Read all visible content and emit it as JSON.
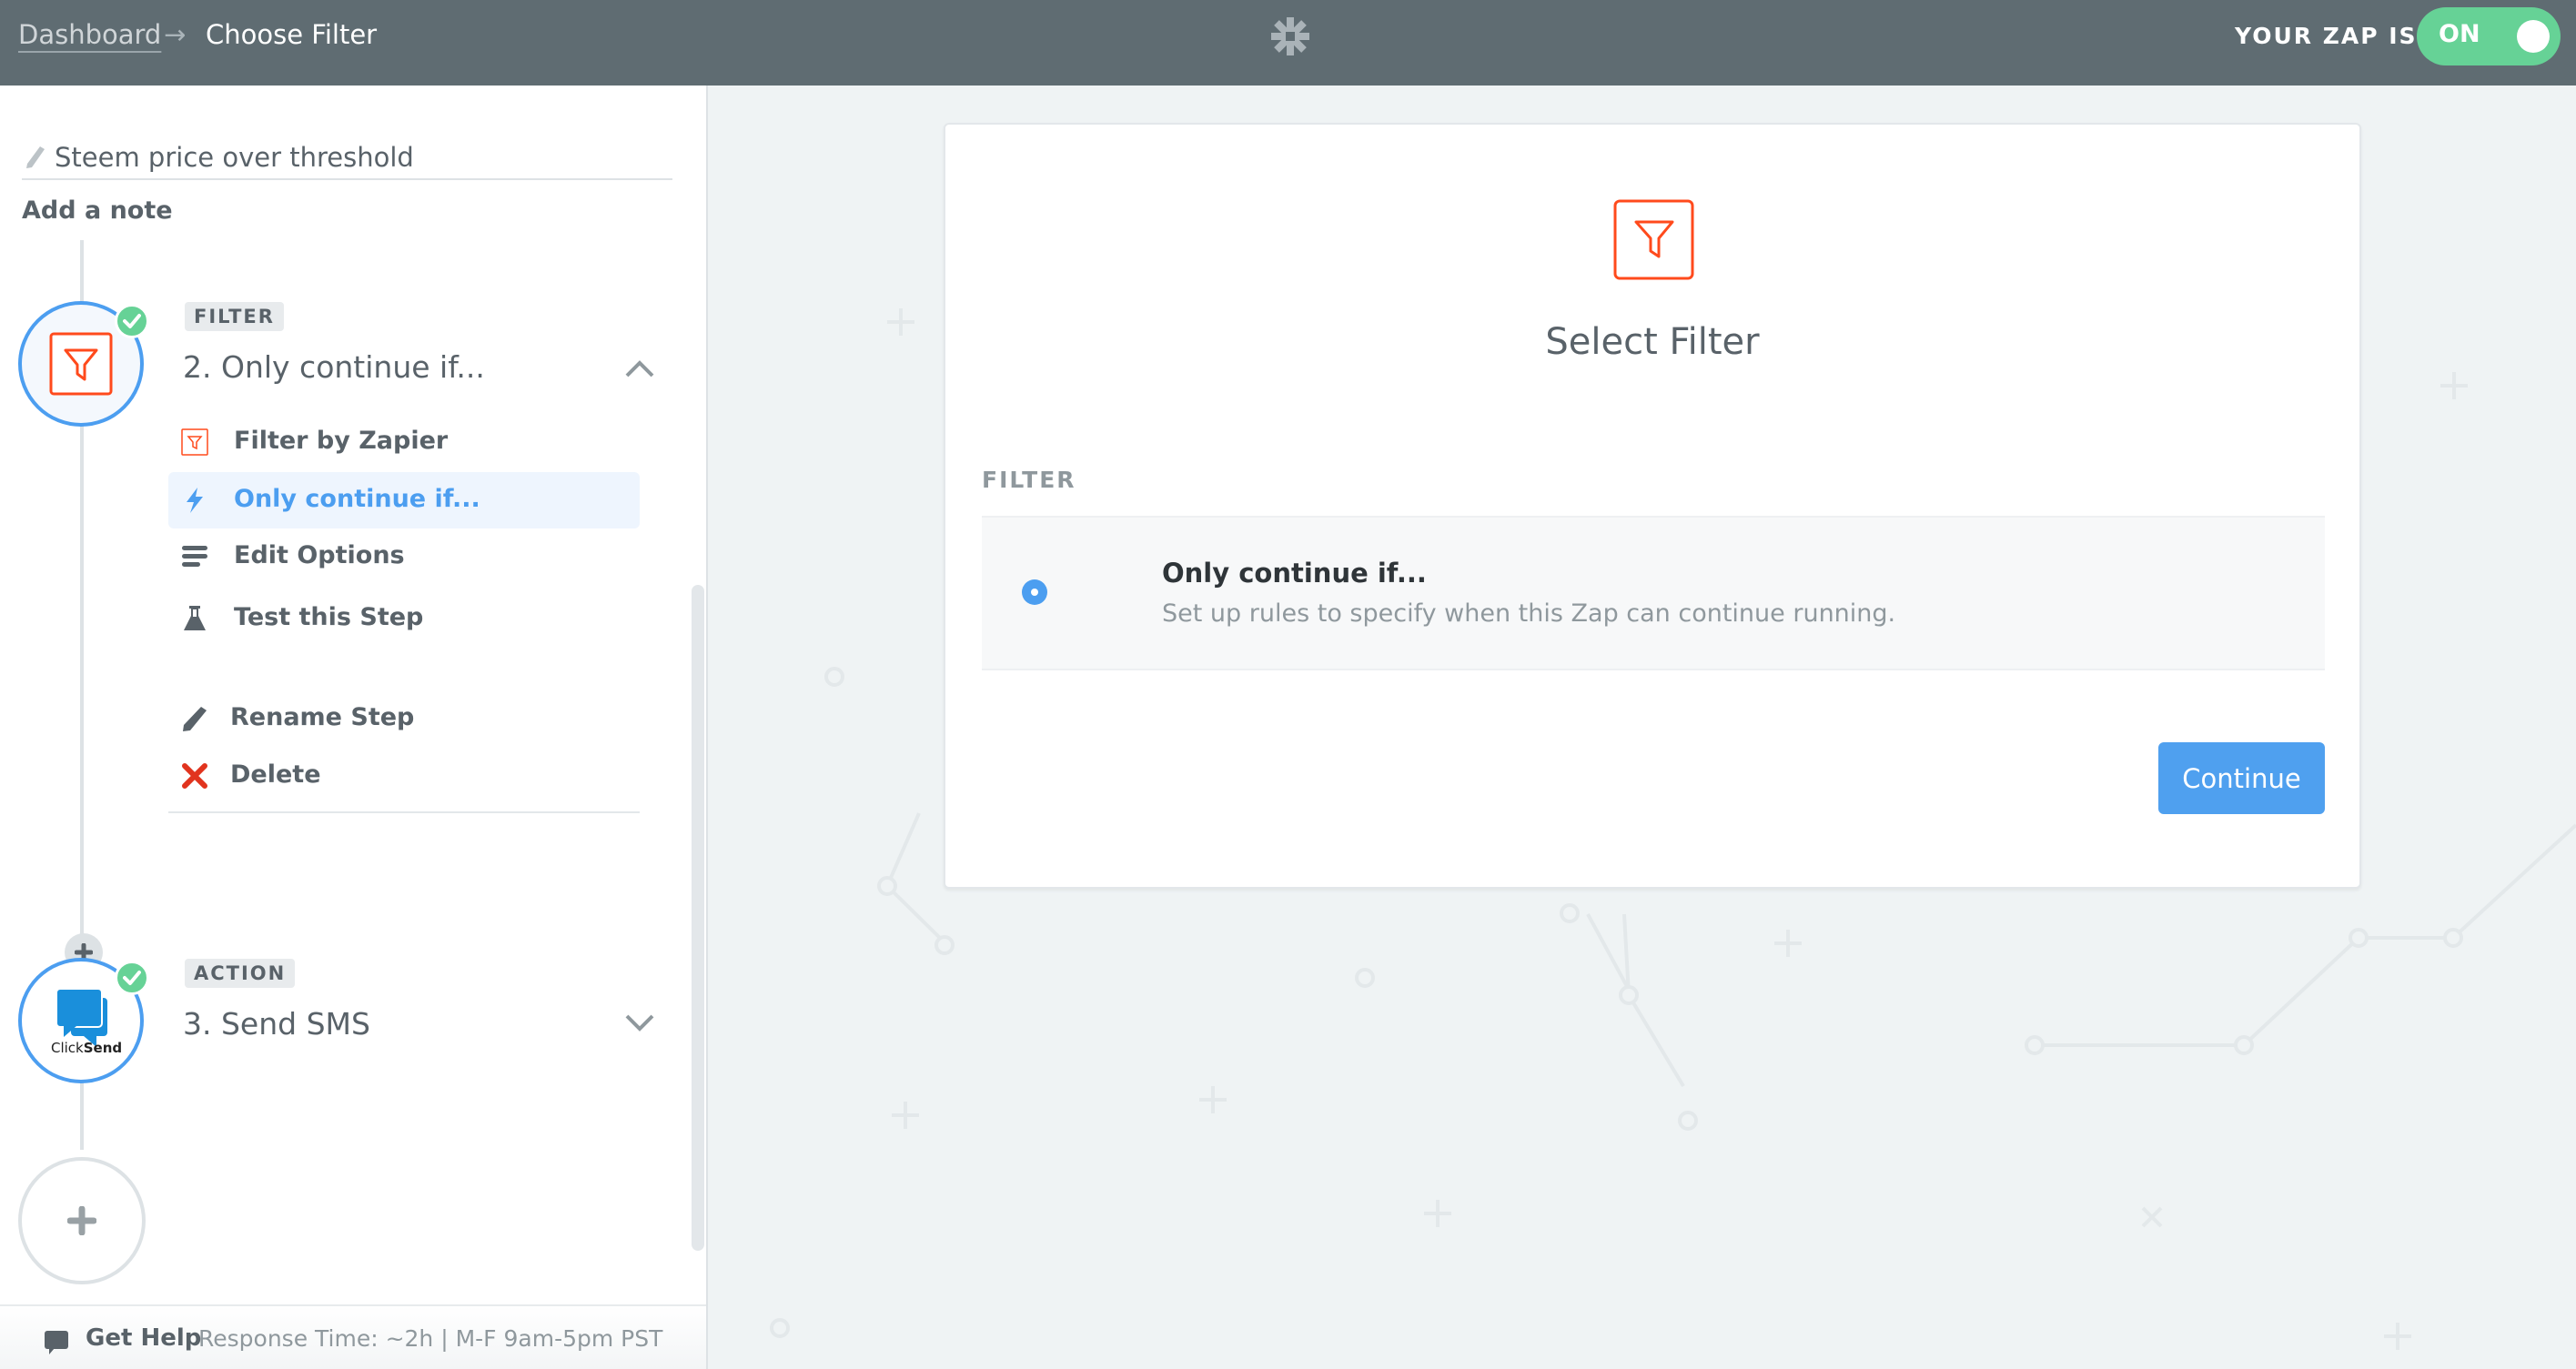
{
  "header": {
    "breadcrumb": {
      "root": "Dashboard",
      "separator": "→",
      "current": "Choose Filter"
    },
    "logo_icon": "zapier-asterisk-icon",
    "zap_status_label": "YOUR ZAP IS",
    "toggle": {
      "label": "ON",
      "state": "on",
      "color": "#66d296"
    }
  },
  "sidebar": {
    "zap_name": "Steem price over threshold",
    "add_note": "Add a note",
    "steps": [
      {
        "tag": "FILTER",
        "title": "2. Only continue if...",
        "icon": "filter-funnel-icon",
        "status": "complete",
        "expanded": true,
        "menu": [
          {
            "label": "Filter by Zapier",
            "icon": "filter-funnel-icon",
            "active": false
          },
          {
            "label": "Only continue if...",
            "icon": "lightning-bolt-icon",
            "active": true
          },
          {
            "label": "Edit Options",
            "icon": "list-lines-icon",
            "active": false
          },
          {
            "label": "Test this Step",
            "icon": "flask-icon",
            "active": false
          },
          {
            "label": "Rename Step",
            "icon": "pencil-icon",
            "active": false
          },
          {
            "label": "Delete",
            "icon": "red-x-icon",
            "active": false
          }
        ]
      },
      {
        "tag": "ACTION",
        "title": "3. Send SMS",
        "icon": "clicksend-logo-icon",
        "app_name_light": "Click",
        "app_name_bold": "Send",
        "status": "complete",
        "expanded": false
      }
    ],
    "footer": {
      "help_label": "Get Help",
      "help_info": "Response Time: ~2h | M-F 9am-5pm PST"
    }
  },
  "main": {
    "card_title": "Select Filter",
    "section_label": "FILTER",
    "options": [
      {
        "title": "Only continue if...",
        "description": "Set up rules to specify when this Zap can continue running.",
        "selected": true
      }
    ],
    "continue_label": "Continue"
  },
  "colors": {
    "header_bg": "#5f6c72",
    "accent_blue": "#4c9ef0",
    "filter_orange": "#ff4a1c",
    "success_green": "#66d296",
    "delete_red": "#e1341e"
  }
}
